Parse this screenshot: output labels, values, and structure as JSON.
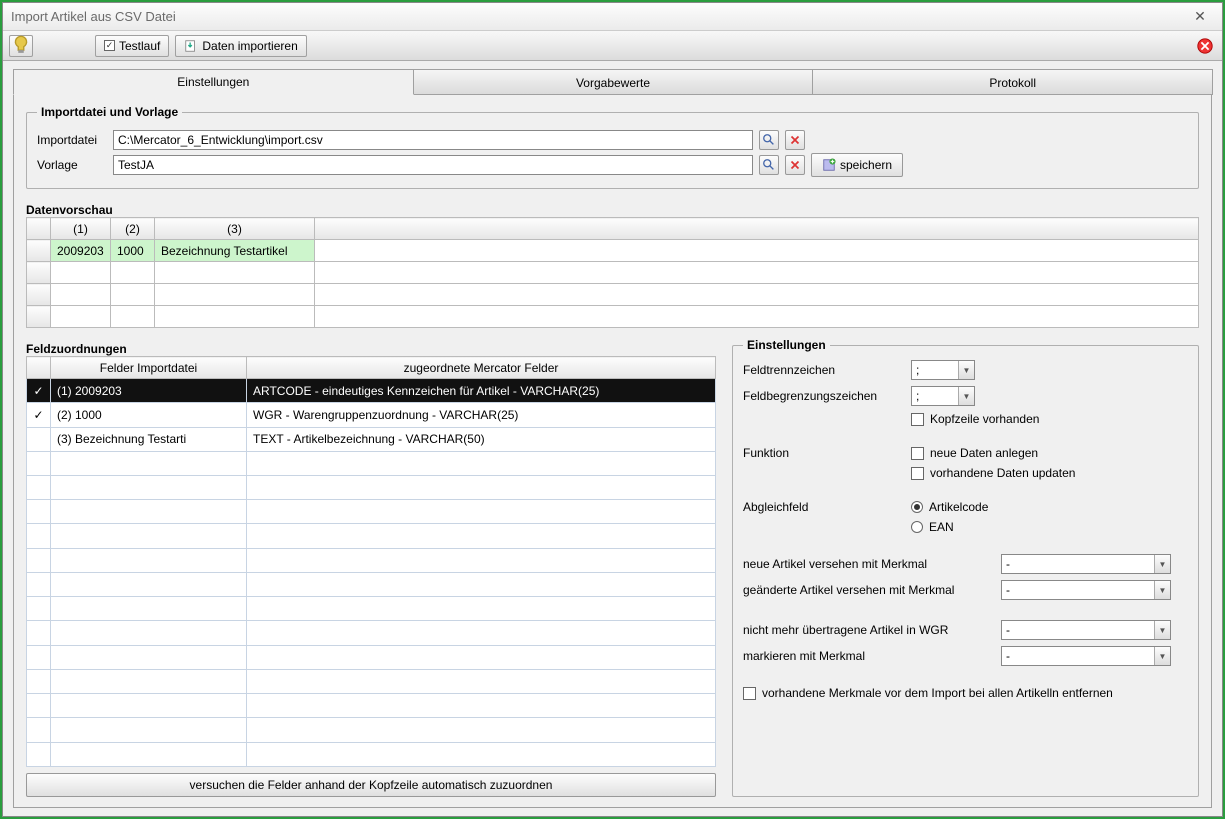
{
  "window": {
    "title": "Import Artikel aus CSV Datei"
  },
  "toolbar": {
    "testlauf": "Testlauf",
    "import": "Daten importieren"
  },
  "tabs": {
    "settings": "Einstellungen",
    "defaults": "Vorgabewerte",
    "log": "Protokoll"
  },
  "fileGroup": {
    "legend": "Importdatei und Vorlage",
    "fileLabel": "Importdatei",
    "fileValue": "C:\\Mercator_6_Entwicklung\\import.csv",
    "templateLabel": "Vorlage",
    "templateValue": "TestJA",
    "saveLabel": "speichern"
  },
  "preview": {
    "label": "Datenvorschau",
    "cols": [
      "(1)",
      "(2)",
      "(3)"
    ],
    "row": [
      "2009203",
      "1000",
      "Bezeichnung Testartikel"
    ]
  },
  "mapping": {
    "label": "Feldzuordnungen",
    "headers": {
      "source": "Felder Importdatei",
      "target": "zugeordnete Mercator Felder"
    },
    "rows": [
      {
        "checked": true,
        "src": "(1) 2009203",
        "dst": "ARTCODE - eindeutiges Kennzeichen für Artikel - VARCHAR(25)"
      },
      {
        "checked": true,
        "src": "(2) 1000",
        "dst": "WGR - Warengruppenzuordnung - VARCHAR(25)"
      },
      {
        "checked": false,
        "src": "(3) Bezeichnung Testarti",
        "dst": "TEXT - Artikelbezeichnung - VARCHAR(50)"
      }
    ],
    "autoBtn": "versuchen die Felder anhand der Kopfzeile automatisch zuzuordnen"
  },
  "settings": {
    "legend": "Einstellungen",
    "fieldSep": "Feldtrennzeichen",
    "fieldSepVal": ";",
    "fieldDelim": "Feldbegrenzungszeichen",
    "fieldDelimVal": ";",
    "headerRow": "Kopfzeile vorhanden",
    "funcLabel": "Funktion",
    "funcNew": "neue Daten anlegen",
    "funcUpdate": "vorhandene Daten updaten",
    "matchLabel": "Abgleichfeld",
    "matchArt": "Artikelcode",
    "matchEan": "EAN",
    "newMarker": "neue Artikel versehen mit Merkmal",
    "chgMarker": "geänderte Artikel versehen mit Merkmal",
    "notTrans": "nicht mehr übertragene Artikel in WGR",
    "markWith": "markieren mit Merkmal",
    "dash": "-",
    "removeExisting": "vorhandene Merkmale vor dem Import  bei allen Artikelln entfernen"
  }
}
